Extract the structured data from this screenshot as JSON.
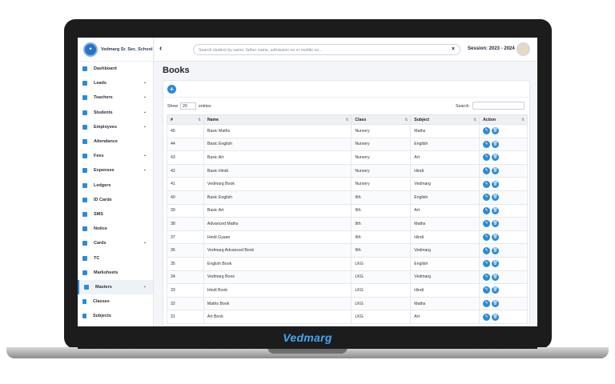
{
  "brand": {
    "logo_text": "Vedmarg"
  },
  "school": {
    "name": "Vedmarg Sr. Sec. School"
  },
  "topbar": {
    "back_icon": "‹",
    "search_placeholder": "Search student by name, father name, admission no or mobile no...",
    "clear_icon": "×",
    "session": "Session: 2023 - 2024"
  },
  "sidebar": {
    "items": [
      {
        "label": "Dashboard",
        "has_chevron": false
      },
      {
        "label": "Leads",
        "has_chevron": true
      },
      {
        "label": "Teachers",
        "has_chevron": true
      },
      {
        "label": "Students",
        "has_chevron": true
      },
      {
        "label": "Employees",
        "has_chevron": true
      },
      {
        "label": "Attendance",
        "has_chevron": false
      },
      {
        "label": "Fees",
        "has_chevron": true
      },
      {
        "label": "Expenses",
        "has_chevron": true
      },
      {
        "label": "Ledgers",
        "has_chevron": false
      },
      {
        "label": "ID Cards",
        "has_chevron": false
      },
      {
        "label": "SMS",
        "has_chevron": false
      },
      {
        "label": "Notice",
        "has_chevron": false
      },
      {
        "label": "Cards",
        "has_chevron": true
      },
      {
        "label": "TC",
        "has_chevron": false
      },
      {
        "label": "Marksheets",
        "has_chevron": false
      },
      {
        "label": "Masters",
        "has_chevron": true,
        "active": true
      },
      {
        "label": "Classes",
        "has_chevron": false
      },
      {
        "label": "Subjects",
        "has_chevron": false
      }
    ],
    "chevron": "⌄"
  },
  "page": {
    "title": "Books",
    "add_icon": "+"
  },
  "table_controls": {
    "show_label": "Show",
    "entries_value": "20",
    "entries_label": "entries",
    "search_label": "Search:"
  },
  "table": {
    "columns": [
      "#",
      "Name",
      "Class",
      "Subject",
      "Action"
    ],
    "rows": [
      {
        "id": "45",
        "name": "Basic Maths",
        "class": "Nursery",
        "subject": "Maths"
      },
      {
        "id": "44",
        "name": "Basic English",
        "class": "Nursery",
        "subject": "English"
      },
      {
        "id": "43",
        "name": "Basic Art",
        "class": "Nursery",
        "subject": "Art"
      },
      {
        "id": "42",
        "name": "Basic Hindi",
        "class": "Nursery",
        "subject": "Hindi"
      },
      {
        "id": "41",
        "name": "Vedmarg Book",
        "class": "Nursery",
        "subject": "Vedmarg"
      },
      {
        "id": "40",
        "name": "Basic English",
        "class": "9th",
        "subject": "English"
      },
      {
        "id": "39",
        "name": "Basic Art",
        "class": "9th",
        "subject": "Art"
      },
      {
        "id": "38",
        "name": "Advanced Maths",
        "class": "9th",
        "subject": "Maths"
      },
      {
        "id": "37",
        "name": "Hindi Gyaan",
        "class": "9th",
        "subject": "Hindi"
      },
      {
        "id": "36",
        "name": "Vedmarg Advanced Book",
        "class": "9th",
        "subject": "Vedmarg"
      },
      {
        "id": "35",
        "name": "English Book",
        "class": "LKG",
        "subject": "English"
      },
      {
        "id": "34",
        "name": "Vedmarg Boos",
        "class": "LKG",
        "subject": "Vedmarg"
      },
      {
        "id": "33",
        "name": "Hindi Book",
        "class": "LKG",
        "subject": "Hindi"
      },
      {
        "id": "32",
        "name": "Maths Book",
        "class": "LKG",
        "subject": "Maths"
      },
      {
        "id": "31",
        "name": "Art Book",
        "class": "LKG",
        "subject": "Art"
      }
    ],
    "edit_icon": "✎",
    "delete_icon": "🗑"
  },
  "colors": {
    "accent": "#2a8bd8",
    "bezel": "#1c1c1c"
  }
}
